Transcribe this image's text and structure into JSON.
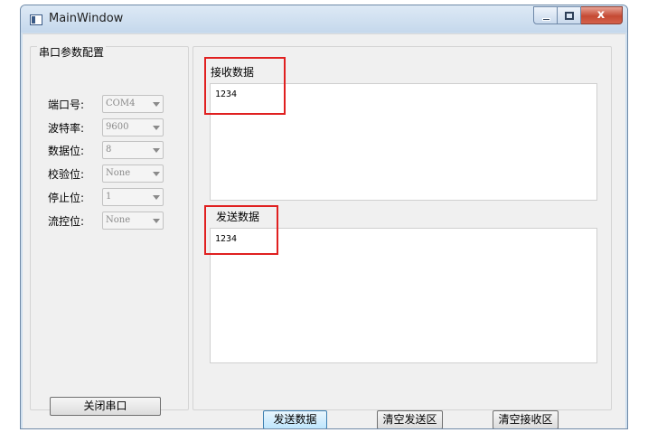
{
  "window": {
    "title": "MainWindow",
    "close_glyph": "x"
  },
  "serial_config": {
    "title": "串口参数配置",
    "fields": [
      {
        "label": "端口号:",
        "value": "COM4"
      },
      {
        "label": "波特率:",
        "value": "9600"
      },
      {
        "label": "数据位:",
        "value": "8"
      },
      {
        "label": "校验位:",
        "value": "None"
      },
      {
        "label": "停止位:",
        "value": "1"
      },
      {
        "label": "流控位:",
        "value": "None"
      }
    ],
    "close_button": "关闭串口"
  },
  "receive": {
    "title": "接收数据",
    "content": "1234"
  },
  "send": {
    "title": "发送数据",
    "content": "1234"
  },
  "buttons": {
    "send": "发送数据",
    "clear_send": "清空发送区",
    "clear_receive": "清空接收区"
  },
  "colors": {
    "highlight": "#e02020",
    "window_frame": "#6f8aa8",
    "close_button": "#c54a33"
  }
}
